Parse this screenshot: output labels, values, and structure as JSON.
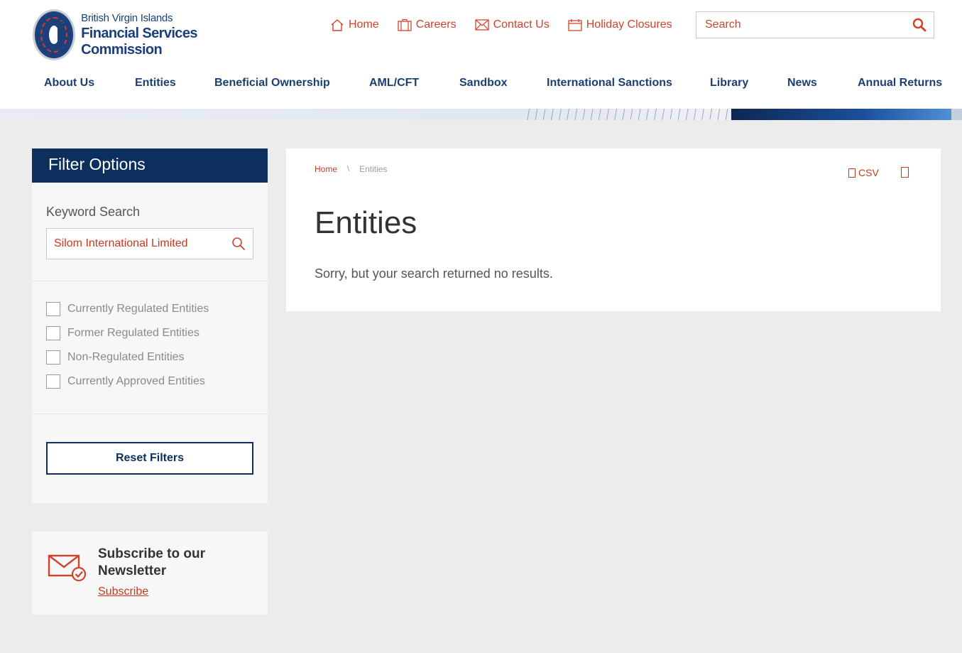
{
  "header": {
    "logo_line1": "British Virgin Islands",
    "logo_line2": "Financial Services Commission",
    "top_links": [
      {
        "label": "Home",
        "icon": "home-icon"
      },
      {
        "label": "Careers",
        "icon": "briefcase-icon"
      },
      {
        "label": "Contact Us",
        "icon": "envelope-icon"
      },
      {
        "label": "Holiday Closures",
        "icon": "calendar-icon"
      }
    ],
    "search": {
      "placeholder": "Search",
      "icon": "search-icon"
    }
  },
  "nav": {
    "items": [
      {
        "label": "About Us"
      },
      {
        "label": "Entities"
      },
      {
        "label": "Beneficial Ownership"
      },
      {
        "label": "AML/CFT"
      },
      {
        "label": "Sandbox"
      },
      {
        "label": "International Sanctions"
      },
      {
        "label": "Library"
      },
      {
        "label": "News"
      },
      {
        "label": "Annual Returns"
      }
    ]
  },
  "sidebar": {
    "title": "Filter Options",
    "keyword_label": "Keyword Search",
    "keyword_value": "Silom International Limited",
    "checkboxes": [
      {
        "label": "Currently Regulated Entities",
        "checked": false
      },
      {
        "label": "Former Regulated Entities",
        "checked": false
      },
      {
        "label": "Non-Regulated Entities",
        "checked": false
      },
      {
        "label": "Currently Approved Entities",
        "checked": false
      }
    ],
    "reset_label": "Reset Filters"
  },
  "newsletter": {
    "title": "Subscribe to our Newsletter",
    "link": "Subscribe",
    "icon": "mail-check-icon"
  },
  "main": {
    "breadcrumb": {
      "home": "Home",
      "separator": "\\",
      "current": "Entities"
    },
    "csv_label": "CSV",
    "title": "Entities",
    "message": "Sorry, but your search returned no results."
  },
  "colors": {
    "navy": "#0d2f5e",
    "accent_red": "#c8391f",
    "page_bg": "#ececec"
  }
}
